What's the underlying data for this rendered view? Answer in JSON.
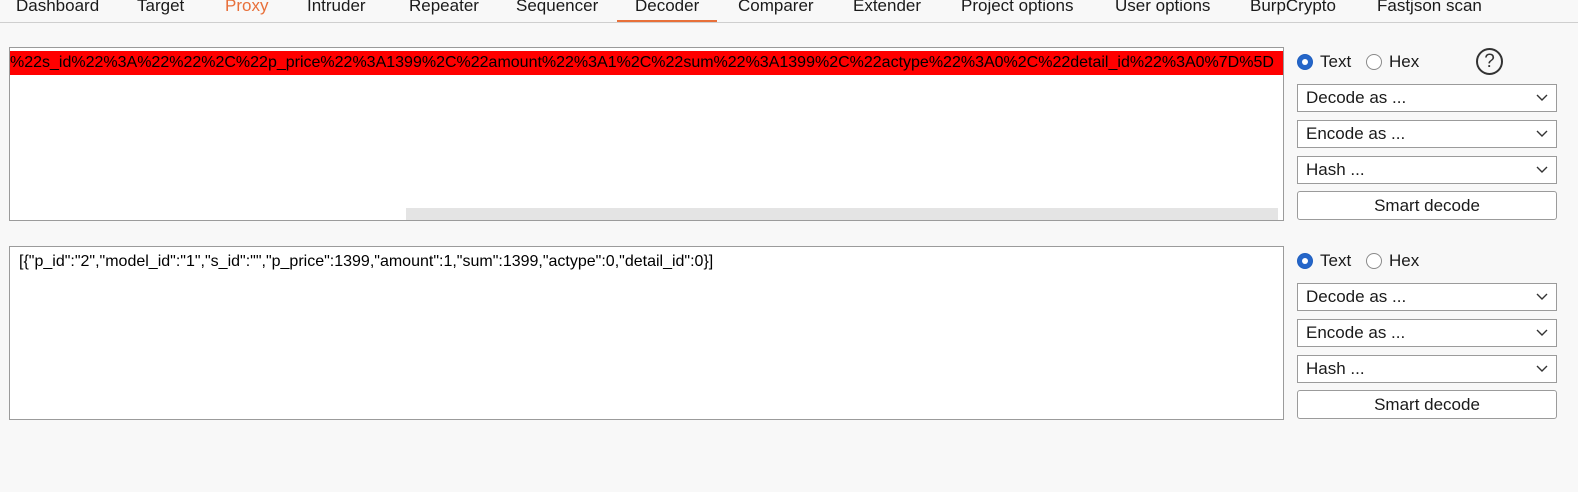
{
  "tabs": [
    {
      "label": "Dashboard",
      "active": false
    },
    {
      "label": "Target",
      "active": false
    },
    {
      "label": "Proxy",
      "active": false
    },
    {
      "label": "Intruder",
      "active": false
    },
    {
      "label": "Repeater",
      "active": false
    },
    {
      "label": "Sequencer",
      "active": false
    },
    {
      "label": "Decoder",
      "active": true
    },
    {
      "label": "Comparer",
      "active": false
    },
    {
      "label": "Extender",
      "active": false
    },
    {
      "label": "Project options",
      "active": false
    },
    {
      "label": "User options",
      "active": false
    },
    {
      "label": "BurpCrypto",
      "active": false
    },
    {
      "label": "Fastjson scan",
      "active": false
    }
  ],
  "colors": {
    "accent": "#e8703a",
    "highlight": "#ff0000",
    "radio_selected": "#2566c9"
  },
  "encoded_panel": {
    "text": "%22s_id%22%3A%22%22%2C%22p_price%22%3A1399%2C%22amount%22%3A1%2C%22sum%22%3A1399%2C%22actype%22%3A0%2C%22detail_id%22%3A0%7D%5D",
    "mode_text_label": "Text",
    "mode_hex_label": "Hex",
    "mode_selected": "Text",
    "help_icon": "?",
    "decode_label": "Decode as ...",
    "encode_label": "Encode as ...",
    "hash_label": "Hash ...",
    "smart_decode_label": "Smart decode"
  },
  "decoded_panel": {
    "text": "[{\"p_id\":\"2\",\"model_id\":\"1\",\"s_id\":\"\",\"p_price\":1399,\"amount\":1,\"sum\":1399,\"actype\":0,\"detail_id\":0}]",
    "mode_text_label": "Text",
    "mode_hex_label": "Hex",
    "mode_selected": "Text",
    "decode_label": "Decode as ...",
    "encode_label": "Encode as ...",
    "hash_label": "Hash ...",
    "smart_decode_label": "Smart decode"
  }
}
